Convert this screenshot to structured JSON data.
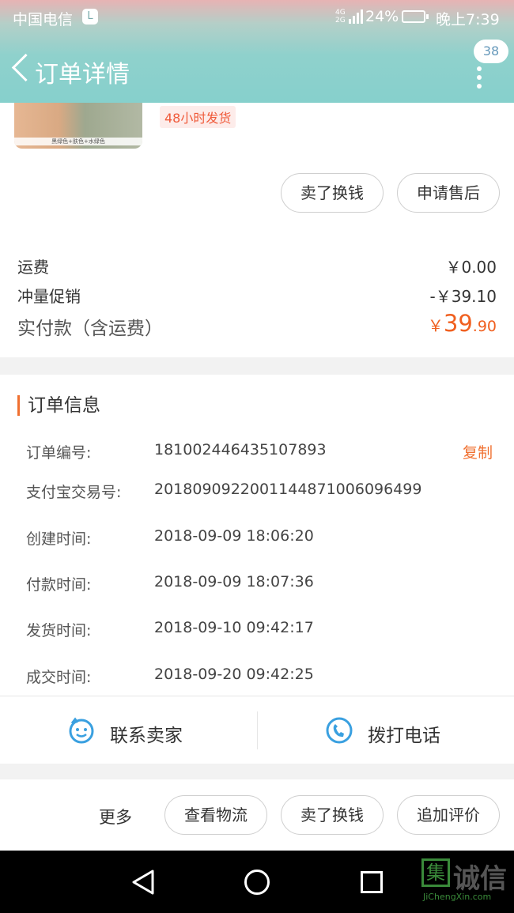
{
  "status_bar": {
    "carrier": "中国电信",
    "carrier_icon": "L",
    "network": "4G 2G",
    "battery_percent": "24%",
    "time": "晚上7:39"
  },
  "header": {
    "title": "订单详情",
    "badge_count": "38"
  },
  "product": {
    "image_caption": "黑绿色+肤色+水绿色",
    "shipping_tag": "48小时发货",
    "buttons": [
      "卖了换钱",
      "申请售后"
    ]
  },
  "summary": {
    "shipping_label": "运费",
    "shipping_value": "￥0.00",
    "promo_label": "冲量促销",
    "promo_value": "-￥39.10",
    "paid_label": "实付款（含运费）",
    "paid_currency": "￥",
    "paid_int": "39",
    "paid_dec": ".90"
  },
  "order_info": {
    "title": "订单信息",
    "copy_label": "复制",
    "rows": [
      {
        "label": "订单编号:",
        "value": "1810024464351078​93"
      },
      {
        "label": "支付宝交易号:",
        "value": "2018090922001144871006096499"
      },
      {
        "label": "创建时间:",
        "value": "2018-09-09 18:06:20"
      },
      {
        "label": "付款时间:",
        "value": "2018-09-09 18:07:36"
      },
      {
        "label": "发货时间:",
        "value": "2018-09-10 09:42:17"
      },
      {
        "label": "成交时间:",
        "value": "2018-09-20 09:42:25"
      }
    ],
    "contact_seller": "联系卖家",
    "call_phone": "拨打电话"
  },
  "actions": {
    "more": "更多",
    "logistics": "查看物流",
    "sell": "卖了换钱",
    "review": "追加评价"
  },
  "watermark": {
    "mark": "集",
    "text": "诚信",
    "url": "JiChengXin.com"
  }
}
